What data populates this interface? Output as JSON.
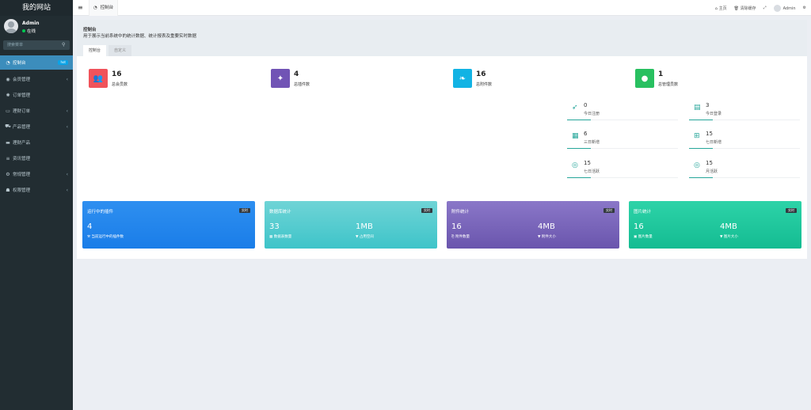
{
  "sidebar": {
    "logo": "我的网站",
    "user_name": "Admin",
    "user_status": "在线",
    "search_placeholder": "搜索菜单",
    "items": [
      {
        "label": "控制台",
        "badge": "hot",
        "icon": "dashboard-icon"
      },
      {
        "label": "会员管理",
        "icon": "user-icon"
      },
      {
        "label": "订单管理",
        "icon": "gear-icon"
      },
      {
        "label": "理财订单",
        "icon": "inbox-icon"
      },
      {
        "label": "产品管理",
        "icon": "cart-icon"
      },
      {
        "label": "理财产品",
        "icon": "laptop-icon"
      },
      {
        "label": "资讯管理",
        "icon": "list-icon"
      },
      {
        "label": "常规管理",
        "icon": "gears-icon"
      },
      {
        "label": "权限管理",
        "icon": "group-icon"
      }
    ]
  },
  "topbar": {
    "tab_label": "控制台",
    "home": "主页",
    "clear_cache": "清除缓存",
    "user": "Admin"
  },
  "page": {
    "title": "控制台",
    "description": "用于展示当前系统中的统计数据、统计报表及重要实时数据",
    "tabs": [
      "控制台",
      "自定义"
    ]
  },
  "stats": [
    {
      "value": "16",
      "label": "总会员数",
      "color": "#f0535b",
      "icon": "users-icon"
    },
    {
      "value": "4",
      "label": "总插件数",
      "color": "#7154b5",
      "icon": "magic-wand-icon"
    },
    {
      "value": "16",
      "label": "总附件数",
      "color": "#12b3e4",
      "icon": "leaf-icon"
    },
    {
      "value": "1",
      "label": "总管理员数",
      "color": "#28c060",
      "icon": "user-icon"
    }
  ],
  "mini_stats": [
    {
      "value": "0",
      "label": "今日注册",
      "icon": "rocket-icon"
    },
    {
      "value": "3",
      "label": "今日登录",
      "icon": "vcard-icon"
    },
    {
      "value": "6",
      "label": "三日新增",
      "icon": "calendar-icon"
    },
    {
      "value": "15",
      "label": "七日新增",
      "icon": "calendar-plus-icon"
    },
    {
      "value": "15",
      "label": "七日活跃",
      "icon": "user-circle-icon"
    },
    {
      "value": "15",
      "label": "月活跃",
      "icon": "user-circle-icon"
    }
  ],
  "cards": [
    {
      "title": "运行中的插件",
      "badge": "实时",
      "gradient": [
        "#2e8ff0",
        "#1a7de8"
      ],
      "metrics": [
        {
          "value": "4",
          "label": "当前运行中的插件数"
        }
      ]
    },
    {
      "title": "数据库统计",
      "badge": "实时",
      "gradient": [
        "#6fd4d6",
        "#3ec4c9"
      ],
      "metrics": [
        {
          "value": "33",
          "label": "数据表数量"
        },
        {
          "value": "1MB",
          "label": "占用空间"
        }
      ]
    },
    {
      "title": "附件统计",
      "badge": "实时",
      "gradient": [
        "#8a77c8",
        "#6a55ad"
      ],
      "metrics": [
        {
          "value": "16",
          "label": "附件数量"
        },
        {
          "value": "4MB",
          "label": "附件大小"
        }
      ]
    },
    {
      "title": "图片统计",
      "badge": "实时",
      "gradient": [
        "#2dd3a8",
        "#14bc92"
      ],
      "metrics": [
        {
          "value": "16",
          "label": "图片数量"
        },
        {
          "value": "4MB",
          "label": "图片大小"
        }
      ]
    }
  ]
}
